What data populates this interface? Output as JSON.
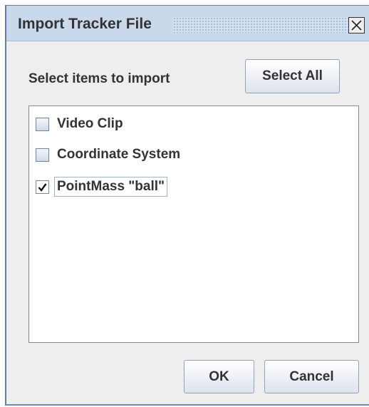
{
  "dialog": {
    "title": "Import Tracker File",
    "close_icon": "close-icon"
  },
  "prompt": "Select items to import",
  "buttons": {
    "select_all": "Select All",
    "ok": "OK",
    "cancel": "Cancel"
  },
  "items": [
    {
      "label": "Video Clip",
      "checked": false
    },
    {
      "label": "Coordinate System",
      "checked": false
    },
    {
      "label": "PointMass \"ball\"",
      "checked": true
    }
  ]
}
